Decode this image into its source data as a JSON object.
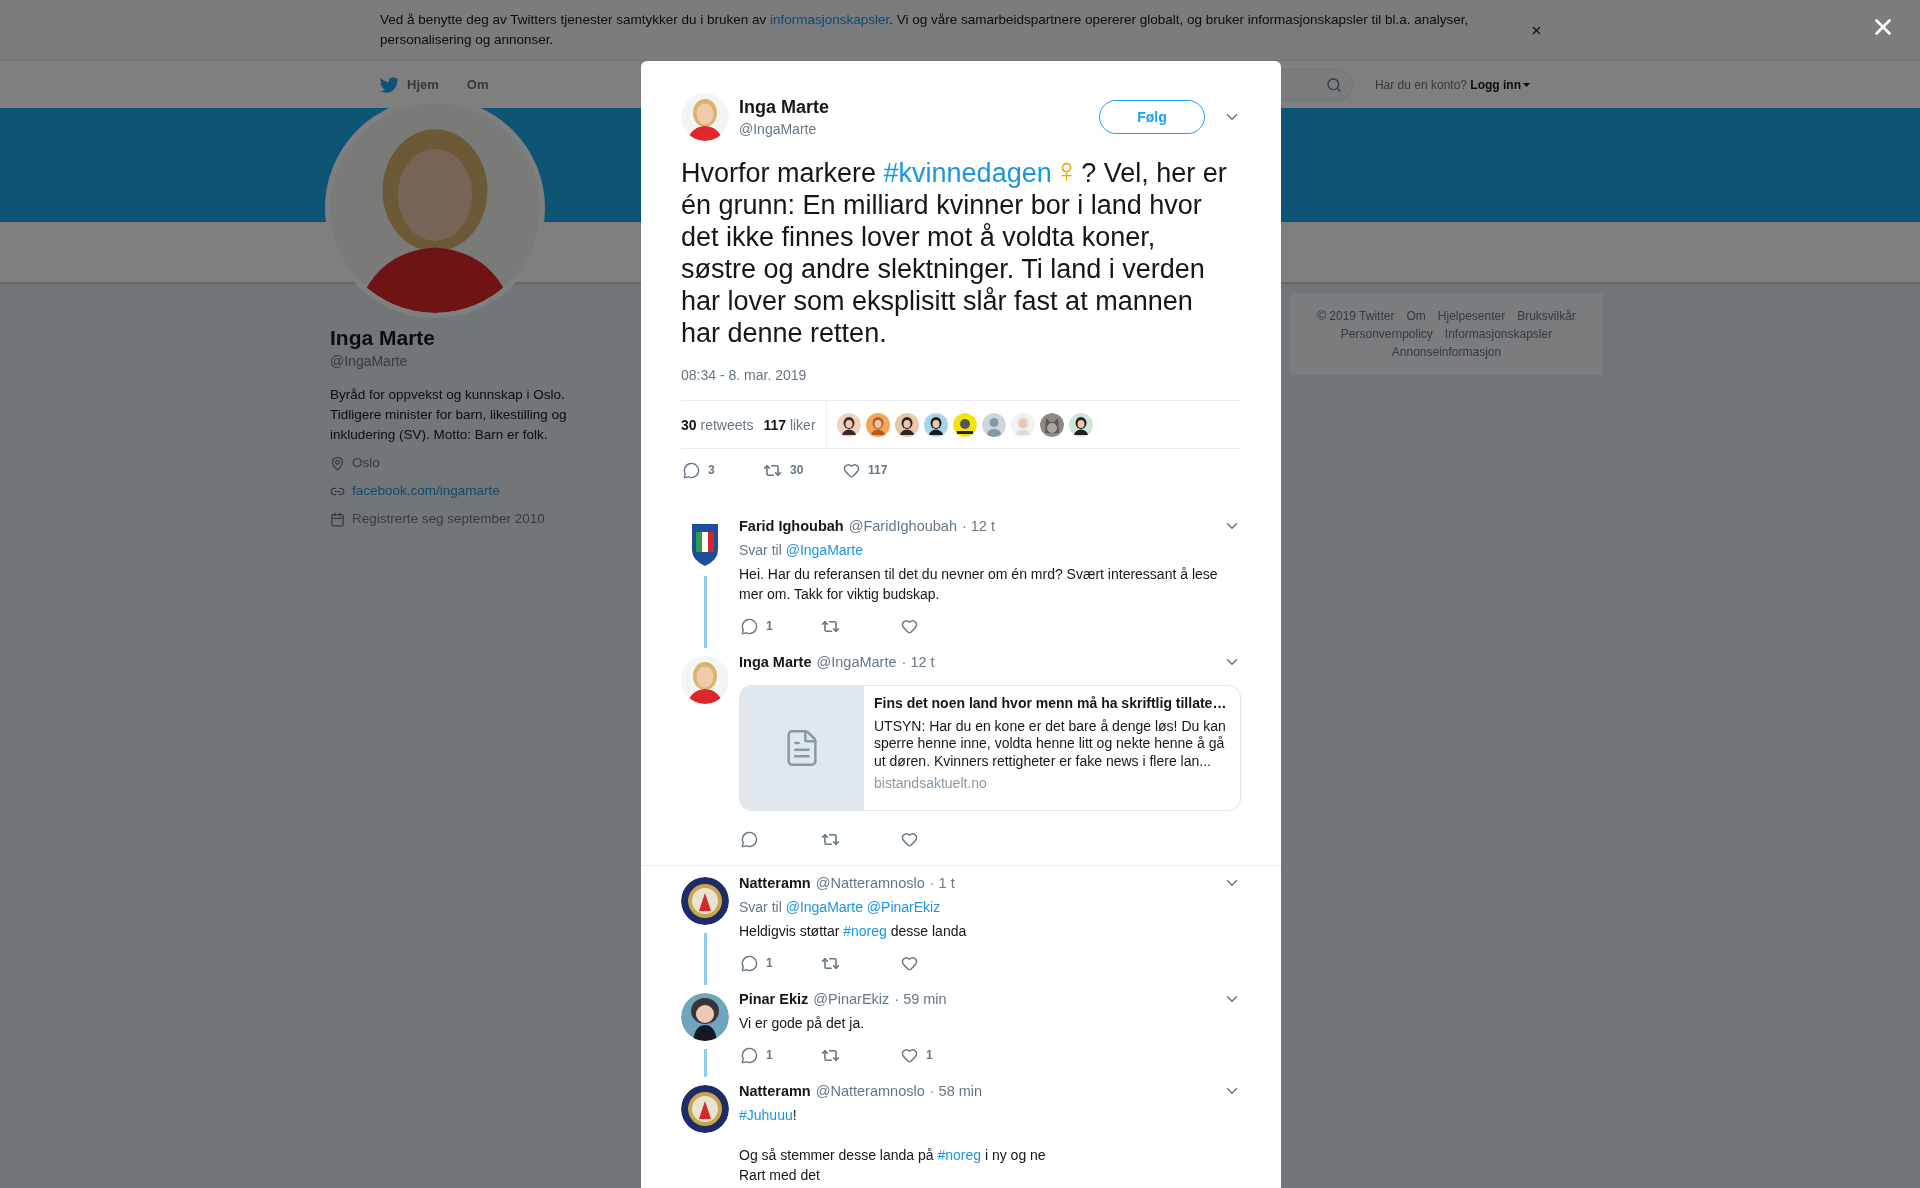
{
  "cookie_banner": {
    "parts": [
      {
        "text": "Ved å benytte deg av Twitters tjenester samtykker du i bruken av "
      },
      {
        "text": "informasjonskapsler",
        "kind": "link"
      },
      {
        "text": ". Vi og våre samarbeidspartnere opererer globalt, og bruker informasjonskapsler til bl.a. analyser, personalisering og annonser."
      }
    ]
  },
  "nav": {
    "items": [
      {
        "label": "Hjem",
        "kind": "home"
      },
      {
        "label": "Om",
        "kind": "plain"
      }
    ],
    "account_prompt": "Har du en konto?",
    "login": "Logg inn"
  },
  "profile": {
    "name": "Inga Marte",
    "handle": "@IngaMarte",
    "bio": "Byråd for oppvekst og kunnskap i Oslo. Tidligere minister for barn, likestilling og inkludering (SV). Motto: Barn er folk.",
    "details": [
      {
        "kind": "location",
        "text": "Oslo"
      },
      {
        "kind": "link",
        "text": "facebook.com/ingamarte"
      },
      {
        "kind": "joined",
        "text": "Registrerte seg september 2010"
      }
    ]
  },
  "footer_links": [
    "© 2019 Twitter",
    "Om",
    "Hjelpesenter",
    "Bruksvilkår",
    "Personvernpolicy",
    "Informasjonskapsler",
    "Annonseinformasjon"
  ],
  "modal": {
    "author": {
      "name": "Inga Marte",
      "handle": "@IngaMarte",
      "avatar": {
        "kind": "person"
      }
    },
    "follow_button": "Følg",
    "parts": [
      {
        "text": "Hvorfor markere "
      },
      {
        "text": "#kvinnedagen",
        "kind": "hashtag"
      },
      {
        "text": "♀",
        "kind": "emoji"
      },
      {
        "text": "? Vel, her er én grunn: En milliard kvinner bor i land hvor det ikke finnes lover mot å voldta koner, søstre og andre slektninger. Ti land i verden har lover som eksplisitt slår fast at mannen har denne retten."
      }
    ],
    "timestamp": "08:34 - 8. mar. 2019",
    "stats": [
      {
        "count": "30",
        "label": "retweets"
      },
      {
        "count": "117",
        "label": "liker"
      }
    ],
    "liker_avatars": [
      {
        "kind": "person"
      },
      {
        "kind": "person"
      },
      {
        "kind": "person"
      },
      {
        "kind": "person"
      },
      {
        "kind": "badge"
      },
      {
        "kind": "default"
      },
      {
        "kind": "person"
      },
      {
        "kind": "cat"
      },
      {
        "kind": "person"
      }
    ],
    "actions": [
      {
        "kind": "reply",
        "count": "3"
      },
      {
        "kind": "retweet",
        "count": "30"
      },
      {
        "kind": "like",
        "count": "117"
      }
    ]
  },
  "conversations": [
    [
      {
        "name": "Farid Ighoubah",
        "handle": "@FaridIghoubah",
        "time": "· 12 t",
        "avatar": {
          "kind": "crest"
        },
        "reply_to": {
          "prefix": "Svar til",
          "mentions": [
            "@IngaMarte"
          ]
        },
        "paragraphs": [
          [
            {
              "text": "Hei. Har du referansen til det du nevner om én mrd? Svært interessant å lese mer om. Takk for viktig budskap."
            }
          ]
        ],
        "actions": [
          {
            "kind": "reply",
            "count": "1"
          },
          {
            "kind": "retweet"
          },
          {
            "kind": "like"
          }
        ]
      },
      {
        "name": "Inga Marte",
        "handle": "@IngaMarte",
        "time": "· 12 t",
        "avatar": {
          "kind": "person"
        },
        "card": {
          "title": "Fins det noen land hvor menn må ha skriftlig tillate…",
          "description": "UTSYN: Har du en kone er det bare å denge løs! Du kan sperre henne inne, voldta henne litt og nekte henne å gå ut døren. Kvinners rettigheter er fake news i flere lan...",
          "domain": "bistandsaktuelt.no"
        },
        "actions": [
          {
            "kind": "reply"
          },
          {
            "kind": "retweet"
          },
          {
            "kind": "like"
          }
        ]
      }
    ],
    [
      {
        "name": "Natteramn",
        "handle": "@Natteramnoslo",
        "time": "· 1 t",
        "avatar": {
          "kind": "seal"
        },
        "reply_to": {
          "prefix": "Svar til",
          "mentions": [
            "@IngaMarte",
            "@PinarEkiz"
          ]
        },
        "paragraphs": [
          [
            {
              "text": "Heldigvis støttar "
            },
            {
              "text": "#noreg",
              "kind": "hashtag"
            },
            {
              "text": " desse landa"
            }
          ]
        ],
        "actions": [
          {
            "kind": "reply",
            "count": "1"
          },
          {
            "kind": "retweet"
          },
          {
            "kind": "like"
          }
        ]
      },
      {
        "name": "Pinar Ekiz",
        "handle": "@PinarEkiz",
        "time": "· 59 min",
        "avatar": {
          "kind": "person2"
        },
        "paragraphs": [
          [
            {
              "text": "Vi er gode på det ja."
            }
          ]
        ],
        "actions": [
          {
            "kind": "reply",
            "count": "1"
          },
          {
            "kind": "retweet"
          },
          {
            "kind": "like",
            "count": "1"
          }
        ]
      },
      {
        "name": "Natteramn",
        "handle": "@Natteramnoslo",
        "time": "· 58 min",
        "avatar": {
          "kind": "seal"
        },
        "paragraphs": [
          [
            {
              "text": "#Juhuuu",
              "kind": "hashtag"
            },
            {
              "text": "!"
            }
          ],
          [
            {
              "text": "Og så stemmer desse landa på "
            },
            {
              "text": "#noreg",
              "kind": "hashtag"
            },
            {
              "text": " i ny og ne\nRart med det"
            }
          ]
        ]
      }
    ]
  ]
}
